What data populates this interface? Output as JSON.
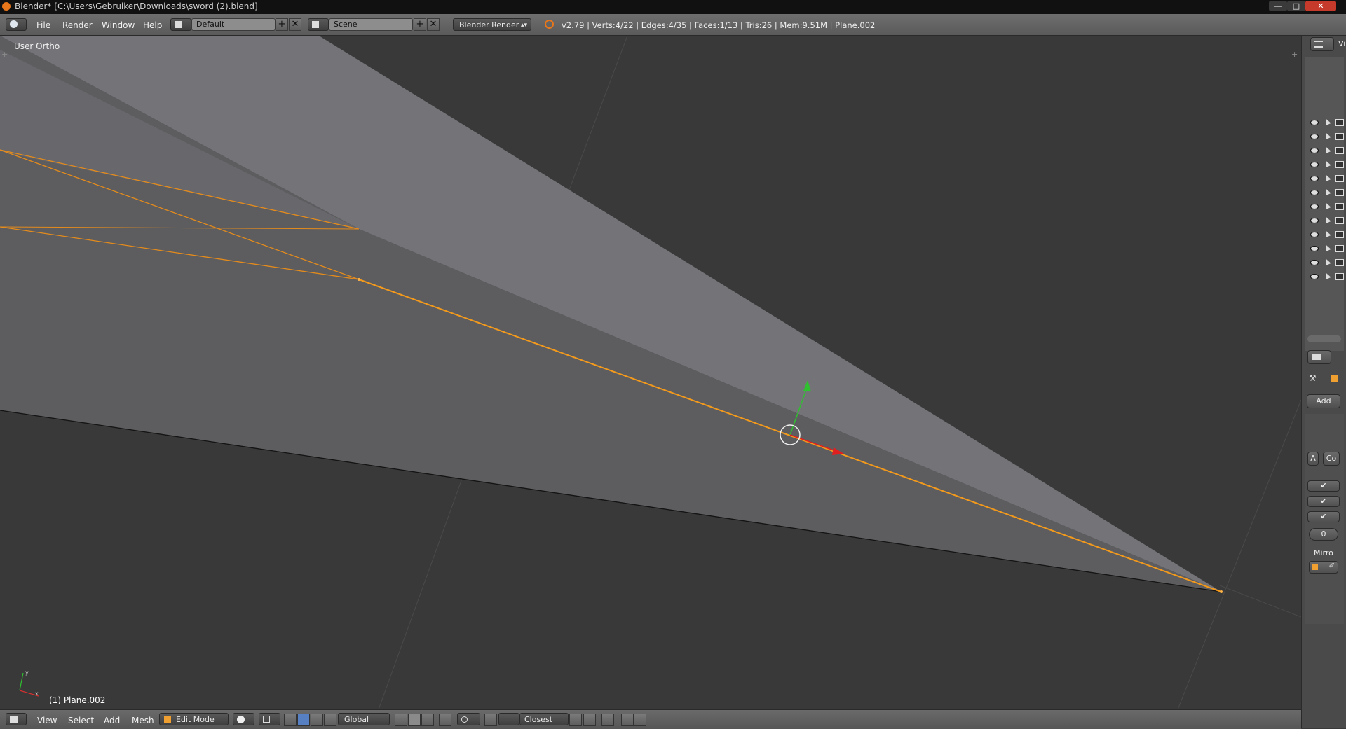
{
  "window": {
    "title": "Blender* [C:\\Users\\Gebruiker\\Downloads\\sword (2).blend]",
    "minimize_icon": "minimize-icon",
    "maximize_icon": "maximize-icon",
    "close_icon": "close-icon"
  },
  "topbar": {
    "menus": [
      "File",
      "Render",
      "Window",
      "Help"
    ],
    "layout_value": "Default",
    "scene_value": "Scene",
    "render_engine": "Blender Render",
    "stats": "v2.79 | Verts:4/22 | Edges:4/35 | Faces:1/13 | Tris:26 | Mem:9.51M | Plane.002"
  },
  "viewport": {
    "view_label": "User Ortho",
    "object_label": "(1) Plane.002",
    "selected_edge_color": "#f39a1c",
    "face_color": "#737378",
    "background_color": "#393939"
  },
  "bottombar": {
    "menus": [
      "View",
      "Select",
      "Add",
      "Mesh"
    ],
    "mode": "Edit Mode",
    "orientation": "Global",
    "snap_target": "Closest"
  },
  "right_panel": {
    "view_tab_label": "Vi",
    "add_label": "Add",
    "a_label": "A",
    "co_label": "Co",
    "value_zero": "0",
    "mirror_label": "Mirro"
  }
}
